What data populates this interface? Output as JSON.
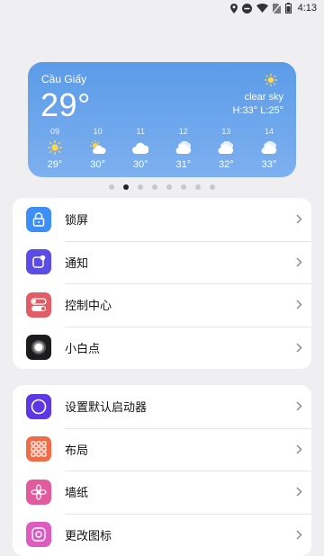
{
  "status": {
    "time": "4:13"
  },
  "weather": {
    "city": "Cầu Giấy",
    "temp": "29°",
    "desc": "clear sky",
    "high_low": "H:33° L:25°",
    "forecast": [
      {
        "hour": "09",
        "icon": "sun-icon",
        "temp": "29°"
      },
      {
        "hour": "10",
        "icon": "sun-cloud-icon",
        "temp": "30°"
      },
      {
        "hour": "11",
        "icon": "cloud-icon",
        "temp": "30°"
      },
      {
        "hour": "12",
        "icon": "clouds-icon",
        "temp": "31°"
      },
      {
        "hour": "13",
        "icon": "clouds-icon",
        "temp": "32°"
      },
      {
        "hour": "14",
        "icon": "clouds-icon",
        "temp": "33°"
      }
    ]
  },
  "pager": {
    "count": 8,
    "active_index": 1
  },
  "section1": [
    {
      "label": "锁屏",
      "icon": "lock-icon",
      "color": "#3e8ef7"
    },
    {
      "label": "通知",
      "icon": "notification-icon",
      "color": "#5b4ce6"
    },
    {
      "label": "控制中心",
      "icon": "toggle-icon",
      "color": "#e25c66"
    },
    {
      "label": "小白点",
      "icon": "assistive-touch-icon",
      "color": "#1c1c1e"
    }
  ],
  "section2": [
    {
      "label": "设置默认启动器",
      "icon": "circle-icon",
      "color": "#5d37e4"
    },
    {
      "label": "布局",
      "icon": "grid-icon",
      "color": "#f26b47"
    },
    {
      "label": "墙纸",
      "icon": "flower-icon",
      "color": "#e45a9f"
    },
    {
      "label": "更改图标",
      "icon": "change-icon",
      "color": "#de5cc0"
    }
  ]
}
